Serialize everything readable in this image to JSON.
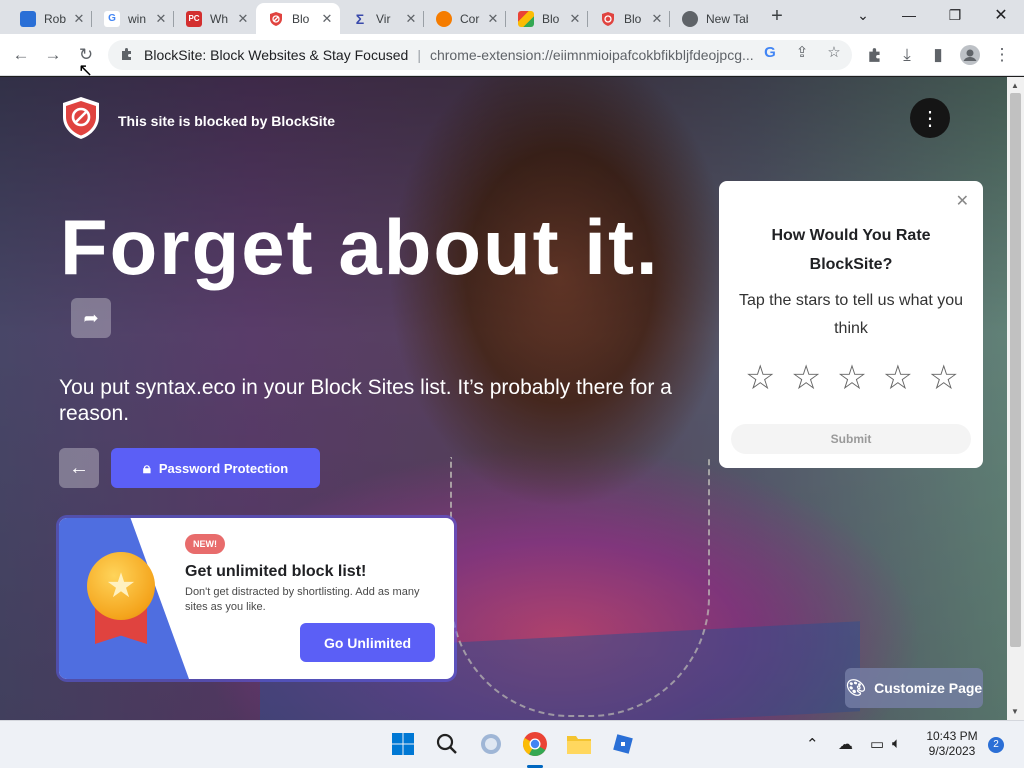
{
  "browser": {
    "tabs": [
      {
        "label": "Rob",
        "icon": "roblox-icon",
        "color": "#2a6fd6",
        "glyph": "",
        "active": false
      },
      {
        "label": "win",
        "icon": "google-icon",
        "color": "#ffffff",
        "glyph": "G",
        "active": false
      },
      {
        "label": "Wh",
        "icon": "pcmag-icon",
        "color": "#d32f2f",
        "glyph": "PC",
        "active": false
      },
      {
        "label": "Blo",
        "icon": "blocksite-icon",
        "color": "#e0433f",
        "glyph": "",
        "active": true
      },
      {
        "label": "Vir",
        "icon": "virustotal-icon",
        "color": "#3949ab",
        "glyph": "Σ",
        "active": false
      },
      {
        "label": "Cor",
        "icon": "avast-icon",
        "color": "#f57c00",
        "glyph": "",
        "active": false
      },
      {
        "label": "Blo",
        "icon": "chrome-web-store-icon",
        "color": "#4caf50",
        "glyph": "",
        "active": false
      },
      {
        "label": "Blo",
        "icon": "blocksite-icon",
        "color": "#e0433f",
        "glyph": "",
        "active": false
      },
      {
        "label": "New Tab",
        "icon": "chrome-icon",
        "color": "#5f6368",
        "glyph": "",
        "active": false
      }
    ],
    "omnibox": {
      "title": "BlockSite: Block Websites & Stay Focused",
      "url": "chrome-extension://eiimnmioipafcokbfikbljfdeojpcg..."
    }
  },
  "page": {
    "brand_text": "This site is blocked by BlockSite",
    "headline": "Forget about it.",
    "message": "You put syntax.eco in your Block Sites list. It’s probably there for a reason.",
    "password_button": "Password Protection",
    "promo": {
      "badge": "NEW!",
      "title": "Get unlimited block list!",
      "description": "Don't get distracted by shortlisting. Add as many sites as you like.",
      "button": "Go Unlimited"
    },
    "rating": {
      "title": "How Would You Rate BlockSite?",
      "subtitle": "Tap the stars to tell us what you think",
      "stars": 5,
      "submit": "Submit"
    },
    "customize_button": "Customize Page"
  },
  "taskbar": {
    "time": "10:43 PM",
    "date": "9/3/2023",
    "notifications": "2"
  },
  "colors": {
    "accent": "#5b5ff6",
    "brand_red": "#e0433f",
    "promo_blue": "#4f6ee0"
  }
}
